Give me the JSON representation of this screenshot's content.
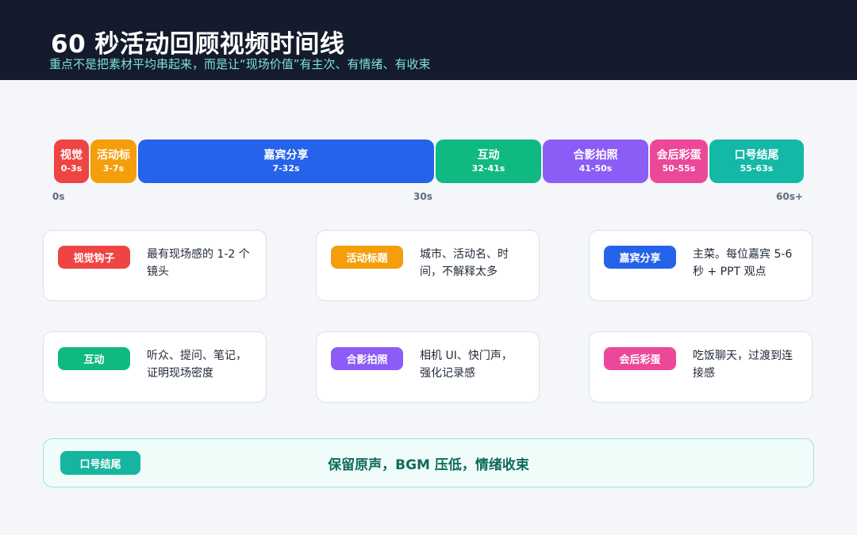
{
  "header": {
    "title": "60 秒活动回顾视频时间线",
    "subtitle": "重点不是把素材平均串起来，而是让“现场价值”有主次、有情绪、有收束"
  },
  "timeline": {
    "segments": [
      {
        "label": "视觉",
        "time": "0-3s",
        "start": 0,
        "end": 3,
        "color": "#ef4444"
      },
      {
        "label": "活动标",
        "time": "3-7s",
        "start": 3,
        "end": 7,
        "color": "#f59e0b"
      },
      {
        "label": "嘉宾分享",
        "time": "7-32s",
        "start": 7,
        "end": 32,
        "color": "#2563eb"
      },
      {
        "label": "互动",
        "time": "32-41s",
        "start": 32,
        "end": 41,
        "color": "#10b981"
      },
      {
        "label": "合影拍照",
        "time": "41-50s",
        "start": 41,
        "end": 50,
        "color": "#8b5cf6"
      },
      {
        "label": "会后彩蛋",
        "time": "50-55s",
        "start": 50,
        "end": 55,
        "color": "#ec4899"
      },
      {
        "label": "口号结尾",
        "time": "55-63s",
        "start": 55,
        "end": 63,
        "color": "#14b8a6"
      }
    ],
    "axis_labels": [
      "0s",
      "30s",
      "60s+"
    ]
  },
  "cards": [
    {
      "tag": "视觉钩子",
      "desc": "最有现场感的 1-2 个镜头",
      "color": "#ef4444"
    },
    {
      "tag": "活动标题",
      "desc": "城市、活动名、时间，不解释太多",
      "color": "#f59e0b"
    },
    {
      "tag": "嘉宾分享",
      "desc": "主菜。每位嘉宾 5-6 秒 + PPT 观点",
      "color": "#2563eb"
    },
    {
      "tag": "互动",
      "desc": "听众、提问、笔记，证明现场密度",
      "color": "#10b981"
    },
    {
      "tag": "合影拍照",
      "desc": "相机 UI、快门声，强化记录感",
      "color": "#8b5cf6"
    },
    {
      "tag": "会后彩蛋",
      "desc": "吃饭聊天，过渡到连接感",
      "color": "#ec4899"
    }
  ],
  "footer": {
    "tag": "口号结尾",
    "text": "保留原声，BGM 压低，情绪收束"
  }
}
